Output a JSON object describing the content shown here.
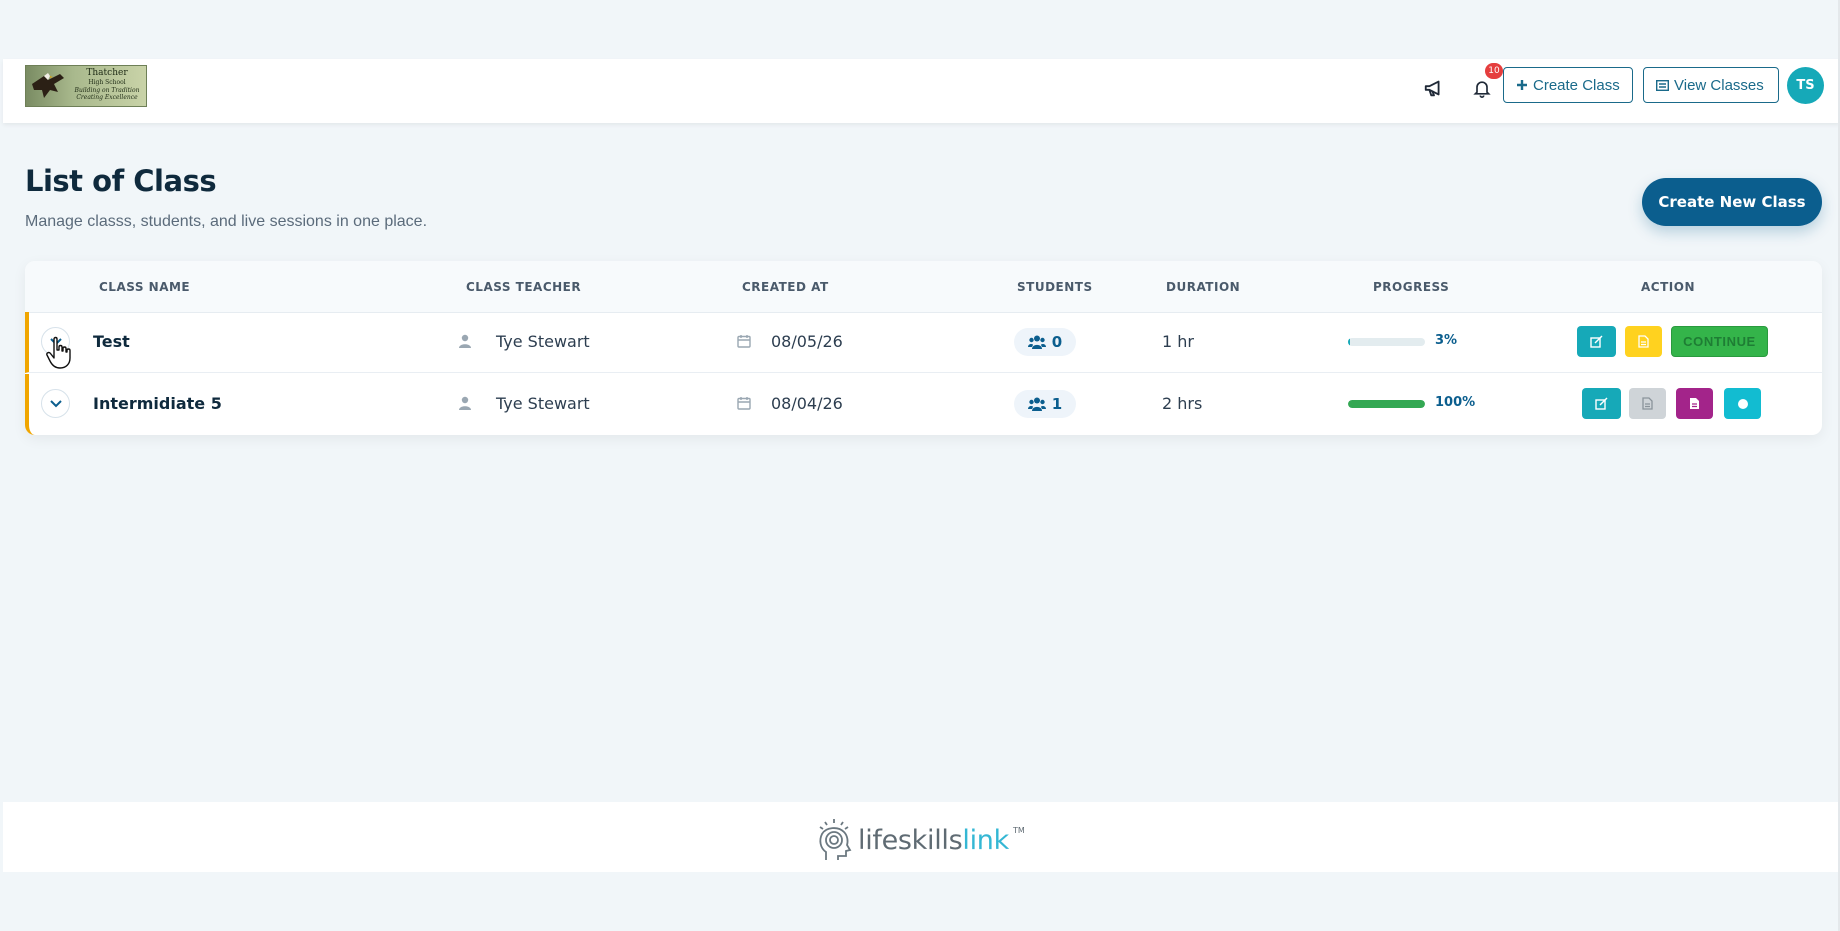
{
  "header": {
    "logo": {
      "school_name": "Thatcher",
      "school_sub": "High School",
      "motto": "Building on Tradition Creating Excellence"
    },
    "notifications_count": "10",
    "create_class_label": "Create Class",
    "view_classes_label": "View Classes",
    "avatar_initials": "TS"
  },
  "page": {
    "title": "List of Class",
    "subtitle": "Manage classs, students, and live sessions in one place.",
    "create_new_label": "Create New Class"
  },
  "table": {
    "columns": [
      "CLASS NAME",
      "CLASS TEACHER",
      "CREATED AT",
      "STUDENTS",
      "DURATION",
      "PROGRESS",
      "ACTION"
    ],
    "rows": [
      {
        "name": "Test",
        "teacher": "Tye Stewart",
        "created_at": "08/05/26",
        "students": "0",
        "duration": "1 hr",
        "progress_label": "3%",
        "progress": 0.03,
        "continue_label": "CONTINUE"
      },
      {
        "name": "Intermidiate 5",
        "teacher": "Tye Stewart",
        "created_at": "08/04/26",
        "students": "1",
        "duration": "2 hrs",
        "progress_label": "100%",
        "progress": 1.0
      }
    ]
  },
  "footer": {
    "brand_part1": "lifeskills",
    "brand_part2": "link",
    "trademark": "TM"
  },
  "colors": {
    "primary": "#0b5e8e",
    "teal": "#16a9b8",
    "yellow": "#ffd21f",
    "green": "#34b44a",
    "purple": "#a3248a",
    "gray": "#cfd4d8",
    "accent_border": "#f0a500"
  },
  "icons": [
    "megaphone-icon",
    "bell-icon",
    "plus-icon",
    "list-icon",
    "user-icon",
    "calendar-icon",
    "users-icon",
    "chevron-down-icon",
    "edit-icon",
    "document-icon",
    "record-icon",
    "hand-cursor-icon"
  ]
}
